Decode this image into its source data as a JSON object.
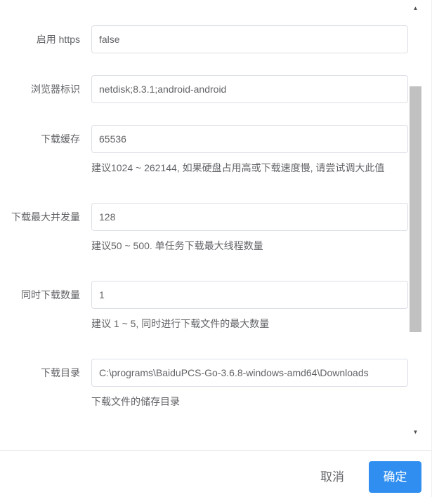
{
  "form": {
    "fields": [
      {
        "label": "启用 https",
        "value": "false"
      },
      {
        "label": "浏览器标识",
        "value": "netdisk;8.3.1;android-android"
      },
      {
        "label": "下载缓存",
        "value": "65536",
        "help": "建议1024 ~ 262144, 如果硬盘占用高或下载速度慢, 请尝试调大此值"
      },
      {
        "label": "下载最大并发量",
        "value": "128",
        "help": "建议50 ~ 500. 单任务下载最大线程数量"
      },
      {
        "label": "同时下载数量",
        "value": "1",
        "help": "建议 1 ~ 5, 同时进行下载文件的最大数量"
      },
      {
        "label": "下载目录",
        "value": "C:\\programs\\BaiduPCS-Go-3.6.8-windows-amd64\\Downloads",
        "help": "下载文件的储存目录"
      }
    ]
  },
  "footer": {
    "cancel_label": "取消",
    "ok_label": "确定"
  },
  "scrollbar": {
    "up_icon": "▲",
    "down_icon": "▼"
  },
  "colors": {
    "primary": "#2f8ef0",
    "text": "#606266",
    "border": "#dcdfe6"
  }
}
